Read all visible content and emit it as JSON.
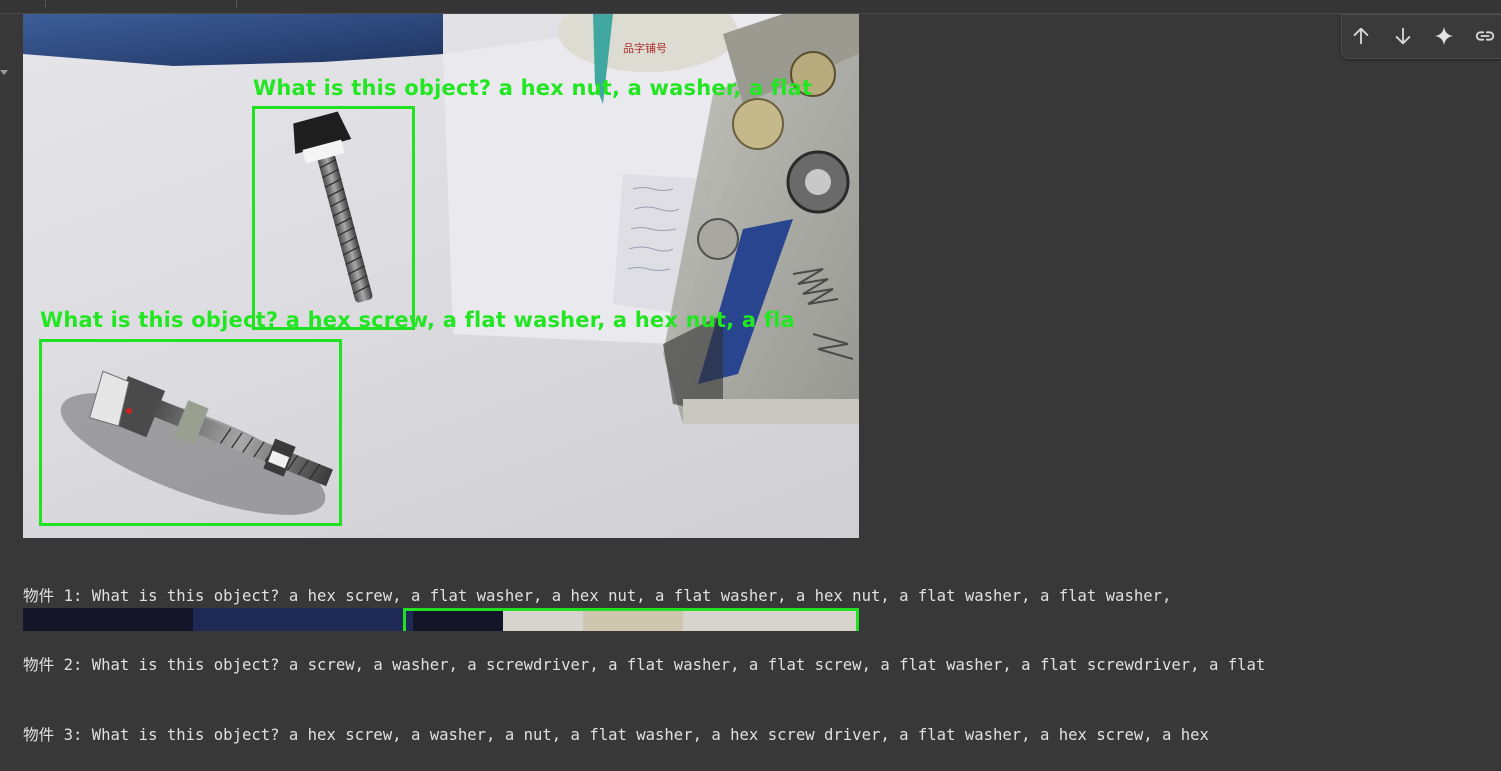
{
  "toolbar": {
    "buttons": [
      {
        "name": "move-up",
        "icon": "arrow-up-icon"
      },
      {
        "name": "move-down",
        "icon": "arrow-down-icon"
      },
      {
        "name": "gemini",
        "icon": "sparkle-icon"
      },
      {
        "name": "link",
        "icon": "link-icon"
      }
    ]
  },
  "image": {
    "detections": [
      {
        "label": "What is this object? a hex nut, a washer, a flat"
      },
      {
        "label": "What is this object? a hex screw, a flat washer, a hex nut, a fla"
      }
    ],
    "background_text": "品字铺号"
  },
  "output": {
    "lines": [
      "物件 1: What is this object? a hex screw, a flat washer, a hex nut, a flat washer, a hex nut, a flat washer, a flat washer,",
      "物件 2: What is this object? a screw, a washer, a screwdriver, a flat washer, a flat screw, a flat washer, a flat screwdriver, a flat",
      "物件 3: What is this object? a hex screw, a washer, a nut, a flat washer, a hex screw driver, a flat washer, a hex screw, a hex"
    ]
  },
  "colors": {
    "background": "#383838",
    "detection_green": "#22e622",
    "text": "#e0e0e0"
  }
}
